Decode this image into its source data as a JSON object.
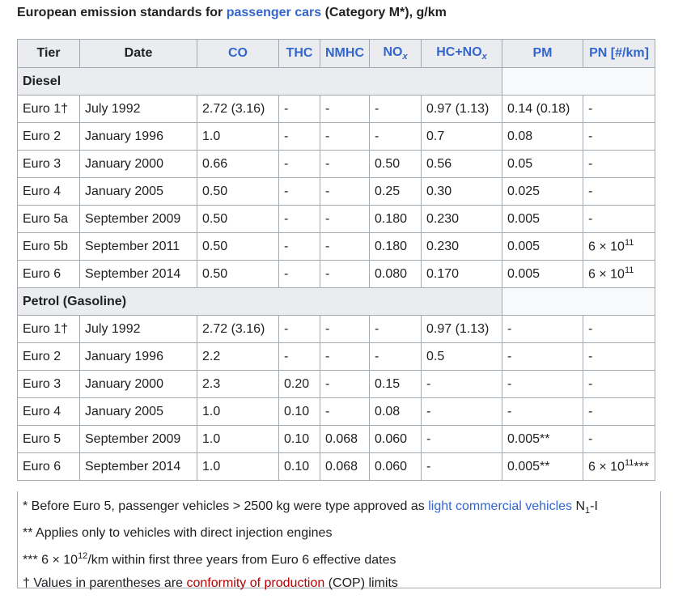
{
  "caption": {
    "pre": "European emission standards for ",
    "link": "passenger cars",
    "post": " (Category M*), g/km"
  },
  "headers": {
    "tier": "Tier",
    "date": "Date",
    "co": "CO",
    "thc": "THC",
    "nmhc": "NMHC",
    "nox_base": "NO",
    "nox_sub": "x",
    "hcnox_base": "HC+NO",
    "hcnox_sub": "x",
    "pm": "PM",
    "pn": "PN [#/km]"
  },
  "sections": [
    {
      "title": "Diesel",
      "rows": [
        {
          "tier": "Euro 1†",
          "date": "July 1992",
          "co": "2.72 (3.16)",
          "thc": "-",
          "nmhc": "-",
          "nox": "-",
          "hcnox": "0.97 (1.13)",
          "pm": "0.14 (0.18)",
          "pn_base": "-",
          "pn_sup": "",
          "pn_suffix": ""
        },
        {
          "tier": "Euro 2",
          "date": "January 1996",
          "co": "1.0",
          "thc": "-",
          "nmhc": "-",
          "nox": "-",
          "hcnox": "0.7",
          "pm": "0.08",
          "pn_base": "-",
          "pn_sup": "",
          "pn_suffix": ""
        },
        {
          "tier": "Euro 3",
          "date": "January 2000",
          "co": "0.66",
          "thc": "-",
          "nmhc": "-",
          "nox": "0.50",
          "hcnox": "0.56",
          "pm": "0.05",
          "pn_base": "-",
          "pn_sup": "",
          "pn_suffix": ""
        },
        {
          "tier": "Euro 4",
          "date": "January 2005",
          "co": "0.50",
          "thc": "-",
          "nmhc": "-",
          "nox": "0.25",
          "hcnox": "0.30",
          "pm": "0.025",
          "pn_base": "-",
          "pn_sup": "",
          "pn_suffix": ""
        },
        {
          "tier": "Euro 5a",
          "date": "September 2009",
          "co": "0.50",
          "thc": "-",
          "nmhc": "-",
          "nox": "0.180",
          "hcnox": "0.230",
          "pm": "0.005",
          "pn_base": "-",
          "pn_sup": "",
          "pn_suffix": ""
        },
        {
          "tier": "Euro 5b",
          "date": "September 2011",
          "co": "0.50",
          "thc": "-",
          "nmhc": "-",
          "nox": "0.180",
          "hcnox": "0.230",
          "pm": "0.005",
          "pn_base": "6 × 10",
          "pn_sup": "11",
          "pn_suffix": ""
        },
        {
          "tier": "Euro 6",
          "date": "September 2014",
          "co": "0.50",
          "thc": "-",
          "nmhc": "-",
          "nox": "0.080",
          "hcnox": "0.170",
          "pm": "0.005",
          "pn_base": "6 × 10",
          "pn_sup": "11",
          "pn_suffix": ""
        }
      ]
    },
    {
      "title": "Petrol (Gasoline)",
      "rows": [
        {
          "tier": "Euro 1†",
          "date": "July 1992",
          "co": "2.72 (3.16)",
          "thc": "-",
          "nmhc": "-",
          "nox": "-",
          "hcnox": "0.97 (1.13)",
          "pm": "-",
          "pn_base": "-",
          "pn_sup": "",
          "pn_suffix": ""
        },
        {
          "tier": "Euro 2",
          "date": "January 1996",
          "co": "2.2",
          "thc": "-",
          "nmhc": "-",
          "nox": "-",
          "hcnox": "0.5",
          "pm": "-",
          "pn_base": "-",
          "pn_sup": "",
          "pn_suffix": ""
        },
        {
          "tier": "Euro 3",
          "date": "January 2000",
          "co": "2.3",
          "thc": "0.20",
          "nmhc": "-",
          "nox": "0.15",
          "hcnox": "-",
          "pm": "-",
          "pn_base": "-",
          "pn_sup": "",
          "pn_suffix": ""
        },
        {
          "tier": "Euro 4",
          "date": "January 2005",
          "co": "1.0",
          "thc": "0.10",
          "nmhc": "-",
          "nox": "0.08",
          "hcnox": "-",
          "pm": "-",
          "pn_base": "-",
          "pn_sup": "",
          "pn_suffix": ""
        },
        {
          "tier": "Euro 5",
          "date": "September 2009",
          "co": "1.0",
          "thc": "0.10",
          "nmhc": "0.068",
          "nox": "0.060",
          "hcnox": "-",
          "pm": "0.005**",
          "pn_base": "-",
          "pn_sup": "",
          "pn_suffix": ""
        },
        {
          "tier": "Euro 6",
          "date": "September 2014",
          "co": "1.0",
          "thc": "0.10",
          "nmhc": "0.068",
          "nox": "0.060",
          "hcnox": "-",
          "pm": "0.005**",
          "pn_base": "6 × 10",
          "pn_sup": "11",
          "pn_suffix": "***"
        }
      ]
    }
  ],
  "notes": {
    "n1_pre": "* Before Euro 5, passenger vehicles > 2500 kg were type approved as ",
    "n1_link": "light commercial vehicles",
    "n1_post": " N",
    "n1_sub": "1",
    "n1_tail": "-I",
    "n2": "** Applies only to vehicles with direct injection engines",
    "n3_pre": "*** 6 × 10",
    "n3_sup": "12",
    "n3_post": "/km within first three years from Euro 6 effective dates",
    "n4_pre": "† Values in parentheses are ",
    "n4_link": "conformity of production",
    "n4_post": " (COP) limits"
  },
  "colors": {
    "link_blue": "#3366cc",
    "link_red": "#ba0000",
    "header_bg": "#eaecf0",
    "border": "#a2a9b1"
  }
}
